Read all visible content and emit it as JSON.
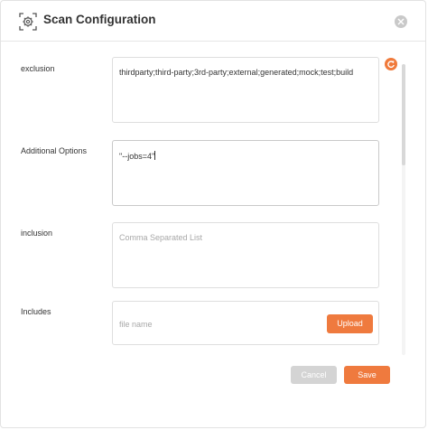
{
  "dialog": {
    "title": "Scan Configuration",
    "icons": {
      "header": "scan-settings-icon",
      "close": "close-icon",
      "reset": "reset-icon"
    },
    "accent_color": "#ef7a3e"
  },
  "fields": {
    "exclusion": {
      "label": "exclusion",
      "value": "thirdparty;third-party;3rd-party;external;generated;mock;test;build"
    },
    "additional_options": {
      "label": "Additional Options",
      "value": "\"--jobs=4\""
    },
    "inclusion": {
      "label": "inclusion",
      "placeholder": "Comma Separated List"
    },
    "includes": {
      "label": "Includes",
      "file_placeholder": "file name",
      "upload_label": "Upload"
    }
  },
  "actions": {
    "cancel_label": "Cancel",
    "save_label": "Save"
  }
}
